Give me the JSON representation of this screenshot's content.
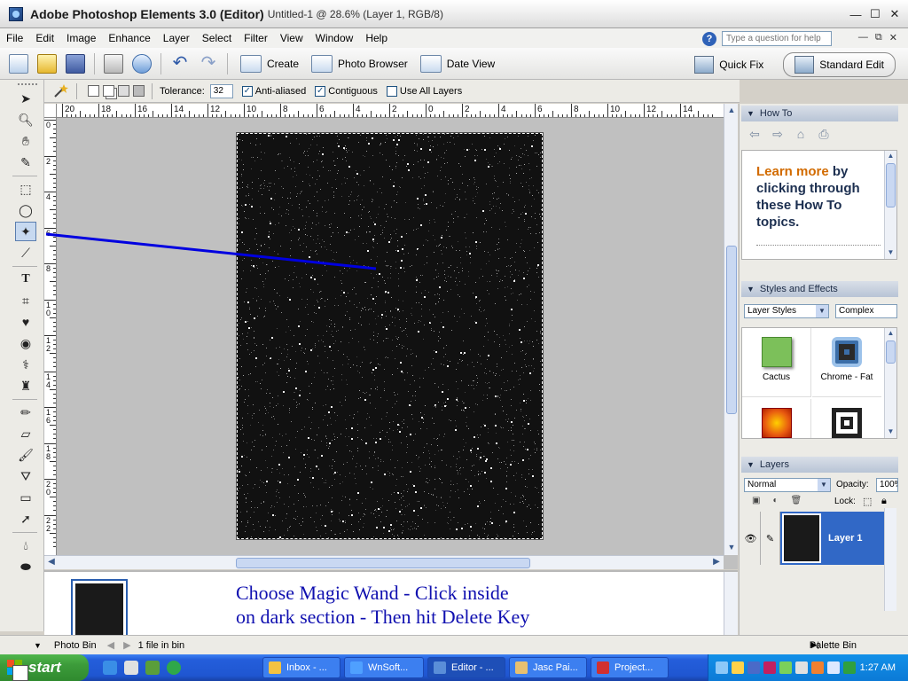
{
  "window": {
    "app_title": "Adobe Photoshop Elements 3.0 (Editor)",
    "doc_title": "Untitled-1 @ 28.6% (Layer 1, RGB/8)"
  },
  "menu": [
    "File",
    "Edit",
    "Image",
    "Enhance",
    "Layer",
    "Select",
    "Filter",
    "View",
    "Window",
    "Help"
  ],
  "help": {
    "placeholder": "Type a question for help"
  },
  "shortcuts": {
    "create": "Create",
    "photo_browser": "Photo Browser",
    "date_view": "Date View",
    "quick_fix": "Quick Fix",
    "standard_edit": "Standard Edit"
  },
  "options": {
    "tolerance_label": "Tolerance:",
    "tolerance_value": "32",
    "anti_aliased": "Anti-aliased",
    "contiguous": "Contiguous",
    "use_all_layers": "Use All Layers",
    "anti_aliased_checked": true,
    "contiguous_checked": true,
    "use_all_layers_checked": false
  },
  "ruler": {
    "top_labels": [
      "20",
      "18",
      "16",
      "14",
      "12",
      "10",
      "8",
      "6",
      "4",
      "2",
      "0",
      "2",
      "4",
      "6",
      "8",
      "10",
      "12",
      "14"
    ],
    "left_labels": [
      "0",
      "2",
      "4",
      "6",
      "8",
      "1 0",
      "1 2",
      "1 4",
      "1 6",
      "1 8",
      "2 0",
      "2 2"
    ]
  },
  "instruction": {
    "line1": "Choose Magic Wand - Click inside",
    "line2": "on dark section - Then hit Delete Key"
  },
  "status": {
    "photo_bin": "Photo Bin",
    "file_count": "1 file in bin",
    "palette_bin": "Palette Bin"
  },
  "howto": {
    "title": "How To",
    "text_highlight": "Learn more",
    "text_rest": " by clicking through these How To topics."
  },
  "styles": {
    "title": "Styles and Effects",
    "category": "Layer Styles",
    "library": "Complex",
    "items": [
      {
        "name": "Cactus",
        "color": "#7cc05a"
      },
      {
        "name": "Chrome - Fat",
        "color": "#3b6ea8"
      },
      {
        "name": "",
        "color": "#e85a10"
      },
      {
        "name": "",
        "color": "#222222"
      }
    ]
  },
  "layers": {
    "title": "Layers",
    "blend_mode": "Normal",
    "opacity_label": "Opacity:",
    "opacity_value": "100%",
    "lock_label": "Lock:",
    "layer_name": "Layer 1"
  },
  "taskbar": {
    "start": "start",
    "tasks": [
      {
        "label": "Inbox - ...",
        "color": "#f5c242"
      },
      {
        "label": "WnSoft...",
        "color": "#4fa0ff"
      },
      {
        "label": "Editor - ...",
        "color": "#5a8ed8"
      },
      {
        "label": "Jasc Pai...",
        "color": "#e8c070"
      },
      {
        "label": "Project...",
        "color": "#d03030"
      }
    ],
    "clock": "1:27 AM"
  },
  "colors": {
    "accent": "#3168c6",
    "instruction": "#1010b0",
    "pointer_line": "#0000e0"
  }
}
